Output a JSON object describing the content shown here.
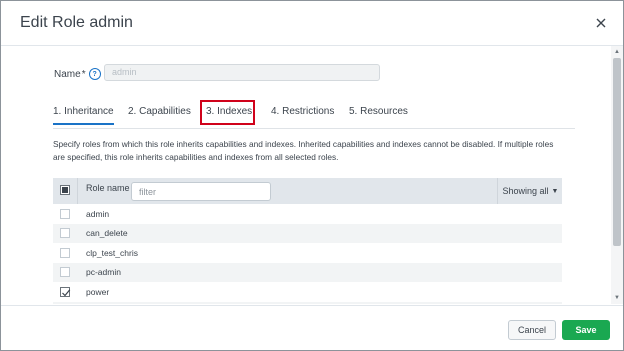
{
  "dialog": {
    "title": "Edit Role admin"
  },
  "name_field": {
    "label": "Name",
    "required_mark": "*",
    "help_icon": "?",
    "value": "admin"
  },
  "tabs": [
    {
      "label": "1. Inheritance",
      "active": true
    },
    {
      "label": "2. Capabilities",
      "active": false
    },
    {
      "label": "3. Indexes",
      "active": false,
      "highlighted": true
    },
    {
      "label": "4. Restrictions",
      "active": false
    },
    {
      "label": "5. Resources",
      "active": false
    }
  ],
  "description": "Specify roles from which this role inherits capabilities and indexes. Inherited capabilities and indexes cannot be disabled. If multiple roles are specified, this role inherits capabilities and indexes from all selected roles.",
  "table": {
    "column_header": "Role name",
    "filter_placeholder": "filter",
    "showing_label": "Showing all",
    "rows": [
      {
        "name": "admin",
        "checked": false
      },
      {
        "name": "can_delete",
        "checked": false
      },
      {
        "name": "clp_test_chris",
        "checked": false
      },
      {
        "name": "pc-admin",
        "checked": false
      },
      {
        "name": "power",
        "checked": true
      }
    ]
  },
  "footer": {
    "cancel_label": "Cancel",
    "save_label": "Save"
  },
  "colors": {
    "save": "#1aa851",
    "accent": "#1a73c7",
    "highlight": "#d0021b"
  }
}
